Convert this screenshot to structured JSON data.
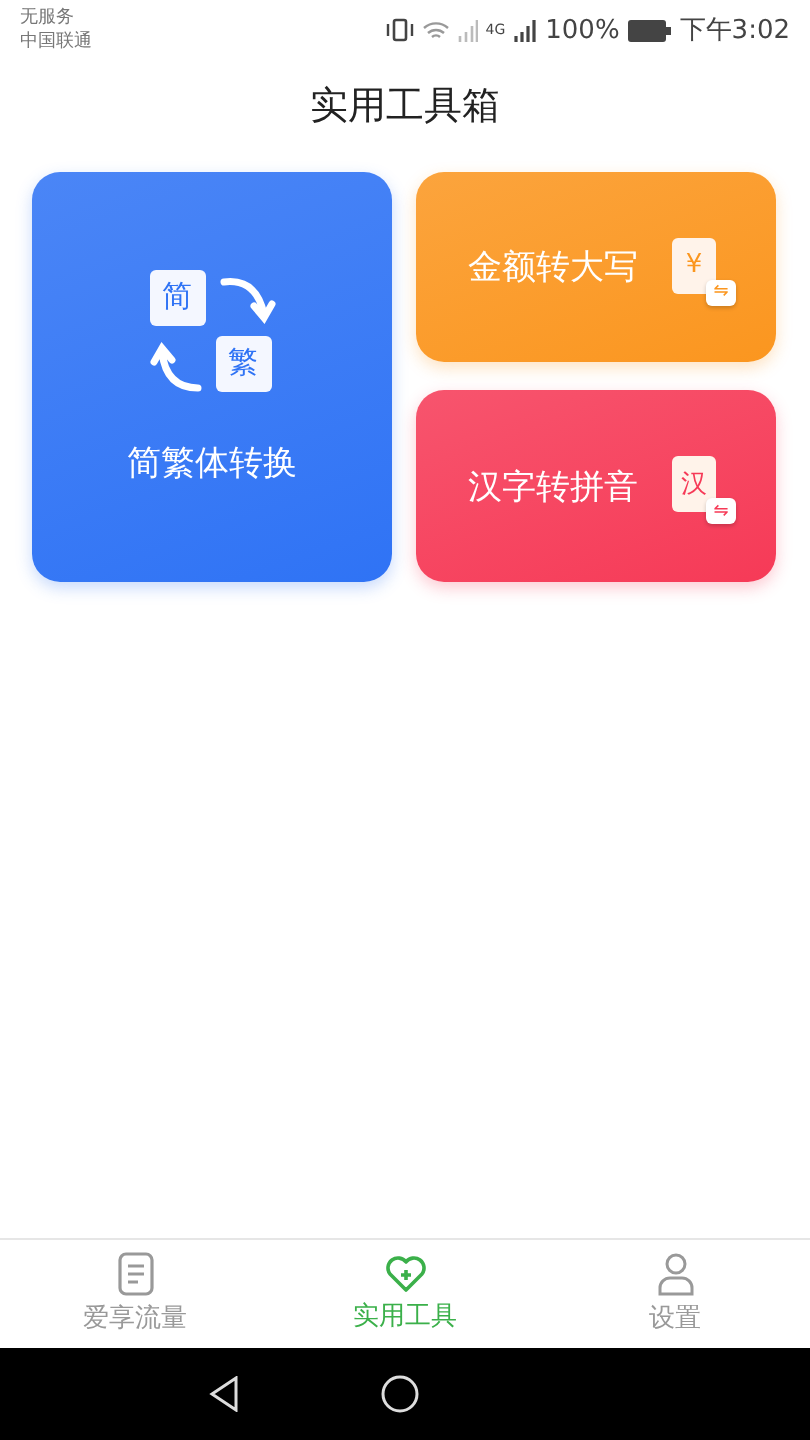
{
  "status_bar": {
    "carrier_lines": [
      "无服务",
      "中国联通"
    ],
    "battery_text": "100%",
    "network_label": "4G",
    "time": "下午3:02"
  },
  "title": "实用工具箱",
  "tools": [
    {
      "kind": "large",
      "label": "简繁体转换",
      "icon_glyphs": [
        "简",
        "繁"
      ],
      "color": "#2f73f5"
    },
    {
      "kind": "small",
      "label": "金额转大写",
      "icon_glyphs": [
        "¥",
        "⇋"
      ],
      "color": "#fb961f"
    },
    {
      "kind": "small",
      "label": "汉字转拼音",
      "icon_glyphs": [
        "汉",
        "⇋"
      ],
      "color": "#f63a57"
    }
  ],
  "tabs": [
    {
      "kind": "document",
      "label": "爱享流量",
      "selected": false
    },
    {
      "kind": "heart",
      "label": "实用工具",
      "selected": true
    },
    {
      "kind": "person",
      "label": "设置",
      "selected": false
    }
  ]
}
